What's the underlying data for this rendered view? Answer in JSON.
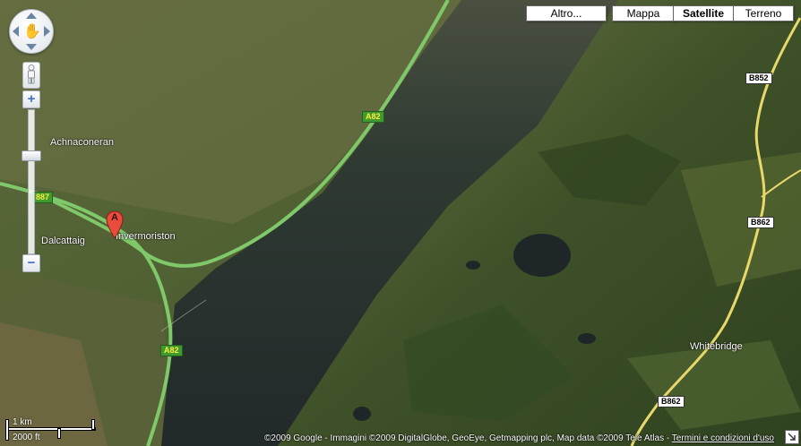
{
  "map_types": {
    "more": "Altro...",
    "map": "Mappa",
    "satellite": "Satellite",
    "terrain": "Terreno",
    "selected": "satellite"
  },
  "places": {
    "achnaconeran": "Achnaconeran",
    "dalcattaig": "Dalcattaig",
    "invermoriston": "Invermoriston",
    "whitebridge": "Whitebridge"
  },
  "roads": {
    "a82_north": "A82",
    "a82_south": "A82",
    "a887": "887",
    "b852": "B852",
    "b862_north": "B862",
    "b862_south": "B862"
  },
  "marker": {
    "letter": "A",
    "color": "#e74c3c"
  },
  "scale": {
    "metric": "1 km",
    "imperial": "2000 ft"
  },
  "copyright": {
    "text": "©2009 Google - Immagini ©2009 DigitalGlobe, GeoEye, Getmapping plc, Map data ©2009 Tele Atlas - ",
    "terms_link": "Termini e condizioni d'uso"
  },
  "controls": {
    "zoom_in": "+",
    "zoom_out": "−"
  },
  "colors": {
    "water": "#2b3330",
    "road_green": "#7fc96a",
    "road_yellow": "#e8d86a"
  }
}
